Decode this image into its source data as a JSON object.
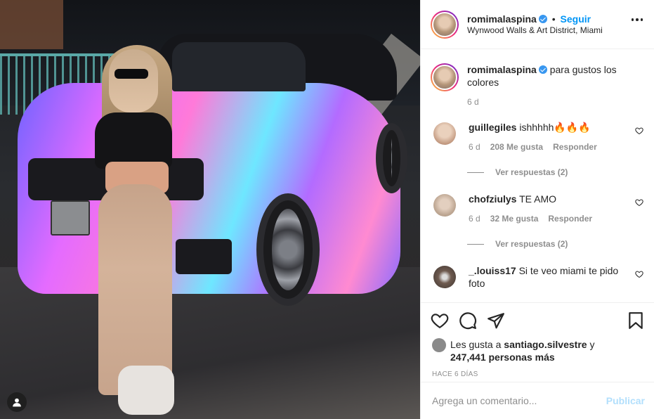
{
  "post": {
    "username": "romimalaspina",
    "separator": "•",
    "follow_label": "Seguir",
    "location": "Wynwood Walls & Art District, Miami",
    "more_icon": "more-horizontal-icon"
  },
  "caption": {
    "username": "romimalaspina",
    "text": "para gustos los colores",
    "age": "6 d"
  },
  "comments": [
    {
      "username": "guillegiles",
      "text": "ishhhhh🔥🔥🔥",
      "age": "6 d",
      "likes": "208 Me gusta",
      "reply_label": "Responder",
      "view_replies": "Ver respuestas (2)",
      "avatar_color": "#d8b9a3"
    },
    {
      "username": "chofziulys",
      "text": "TE AMO",
      "age": "6 d",
      "likes": "32 Me gusta",
      "reply_label": "Responder",
      "view_replies": "Ver respuestas (2)",
      "avatar_color": "#c9b7a8"
    },
    {
      "username": "_.louiss17",
      "text": "Si te veo miami te pido foto",
      "avatar_color": "#6e5a4f"
    }
  ],
  "likes": {
    "prefix": "Les gusta a",
    "user": "santiago.silvestre",
    "connector": "y",
    "count": "247,441 personas más"
  },
  "timestamp": "HACE 6 DÍAS",
  "add_comment": {
    "placeholder": "Agrega un comentario...",
    "publish_label": "Publicar"
  },
  "colors": {
    "accent": "#0095f6",
    "verified": "#3897f0",
    "muted": "#8e8e8e",
    "publish_disabled": "#b2dffc"
  }
}
